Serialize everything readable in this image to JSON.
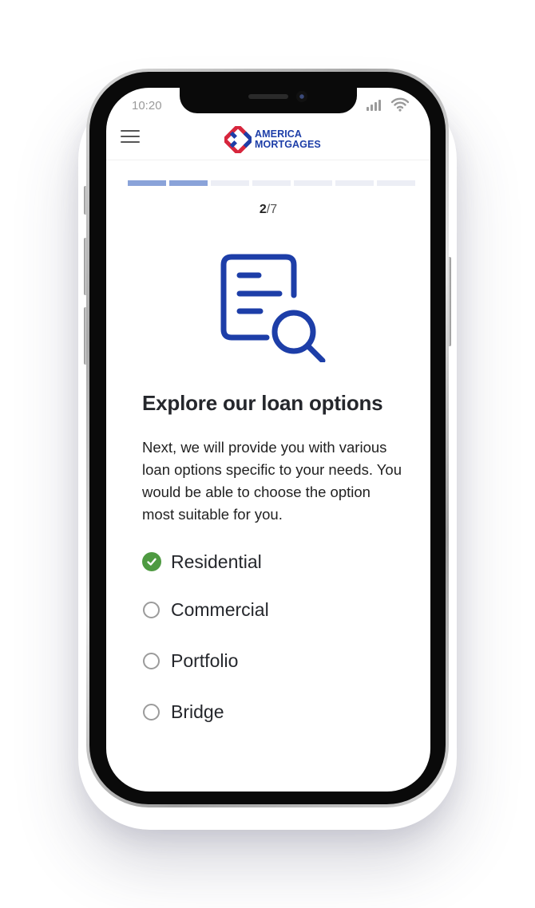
{
  "status_bar": {
    "time": "10:20"
  },
  "header": {
    "logo_line1": "AMERICA",
    "logo_line2": "MORTGAGES"
  },
  "progress": {
    "current": "2",
    "separator_total": "/7",
    "total_steps": 7,
    "completed_steps": 2
  },
  "content": {
    "title": "Explore our loan options",
    "description": "Next, we will provide you with various loan options specific to your needs. You would be able to choose the option most suitable for you.",
    "icon": "document-search-icon"
  },
  "options": [
    {
      "label": "Residential",
      "checked": true
    },
    {
      "label": "Commercial",
      "checked": false
    },
    {
      "label": "Portfolio",
      "checked": false
    },
    {
      "label": "Bridge",
      "checked": false
    }
  ],
  "colors": {
    "brand_blue": "#1d3ea8",
    "brand_red": "#d7263d",
    "progress_done": "#8aa3d9",
    "progress_pending": "#eceef5",
    "check_green": "#4e9a41"
  }
}
